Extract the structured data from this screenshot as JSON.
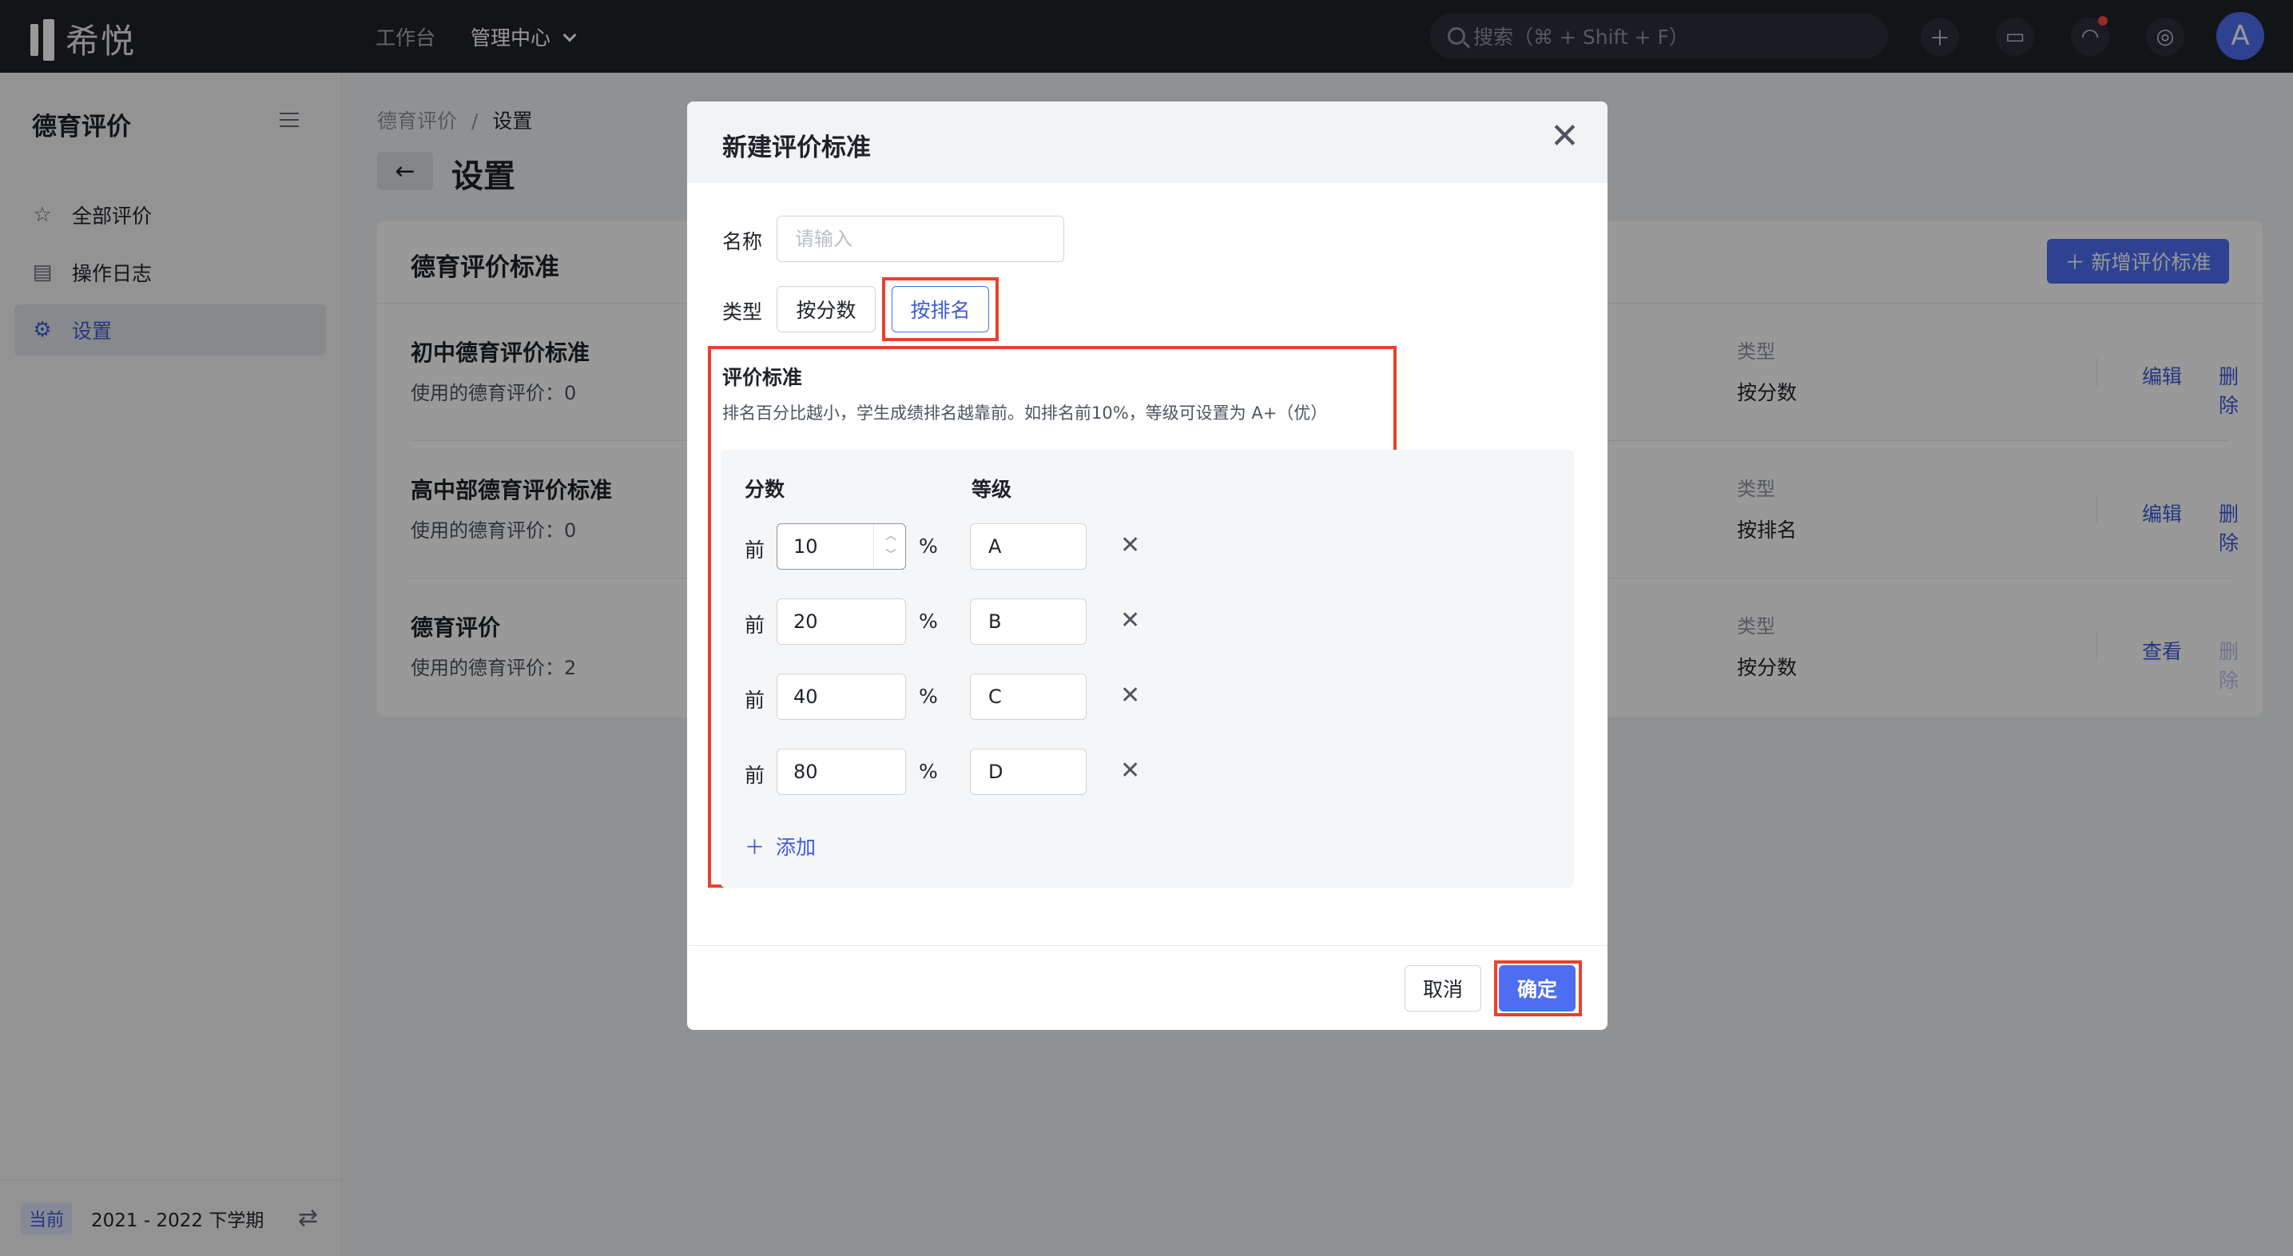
{
  "topbar": {
    "logo_text": "希悦",
    "nav": [
      {
        "label": "工作台",
        "active": false
      },
      {
        "label": "管理中心",
        "active": true
      }
    ],
    "search_placeholder": "搜索（⌘ + Shift + F）",
    "avatar_letter": "A",
    "icons": [
      "plus-icon",
      "chat-icon",
      "bell-icon",
      "compass-icon"
    ]
  },
  "sidebar": {
    "title": "德育评价",
    "items": [
      {
        "label": "全部评价",
        "icon": "star-icon",
        "active": false
      },
      {
        "label": "操作日志",
        "icon": "log-icon",
        "active": false
      },
      {
        "label": "设置",
        "icon": "gear-icon",
        "active": true
      }
    ],
    "term_badge": "当前",
    "term_text": "2021 - 2022 下学期"
  },
  "breadcrumb": {
    "parent": "德育评价",
    "separator": "/",
    "current": "设置"
  },
  "page_title": "设置",
  "panel": {
    "title": "德育评价标准",
    "add_button": "新增评价标准",
    "rows": [
      {
        "name": "初中德育评价标准",
        "used": "使用的德育评价：0",
        "type_label": "类型",
        "type_value": "按分数",
        "action1": "编辑",
        "action2": "删除",
        "action2_disabled": false
      },
      {
        "name": "高中部德育评价标准",
        "used": "使用的德育评价：0",
        "type_label": "类型",
        "type_value": "按排名",
        "action1": "编辑",
        "action2": "删除",
        "action2_disabled": false
      },
      {
        "name": "德育评价",
        "used": "使用的德育评价：2",
        "type_label": "类型",
        "type_value": "按分数",
        "action1": "查看",
        "action2": "删除",
        "action2_disabled": true
      }
    ]
  },
  "modal": {
    "title": "新建评价标准",
    "name_label": "名称",
    "name_placeholder": "请输入",
    "type_label": "类型",
    "type_options": [
      "按分数",
      "按排名"
    ],
    "type_selected": "按排名",
    "criteria_title": "评价标准",
    "criteria_desc": "排名百分比越小，学生成绩排名越靠前。如排名前10%，等级可设置为 A+（优）",
    "col_score": "分数",
    "col_grade": "等级",
    "tier_prefix": "前",
    "tier_unit": "%",
    "tiers": [
      {
        "percent": "10",
        "grade": "A"
      },
      {
        "percent": "20",
        "grade": "B"
      },
      {
        "percent": "40",
        "grade": "C"
      },
      {
        "percent": "80",
        "grade": "D"
      }
    ],
    "add_label": "添加",
    "cancel": "取消",
    "confirm": "确定"
  },
  "colors": {
    "accent": "#4e6ef2",
    "highlight_box": "#e8412c",
    "topbar": "#1f2229"
  }
}
